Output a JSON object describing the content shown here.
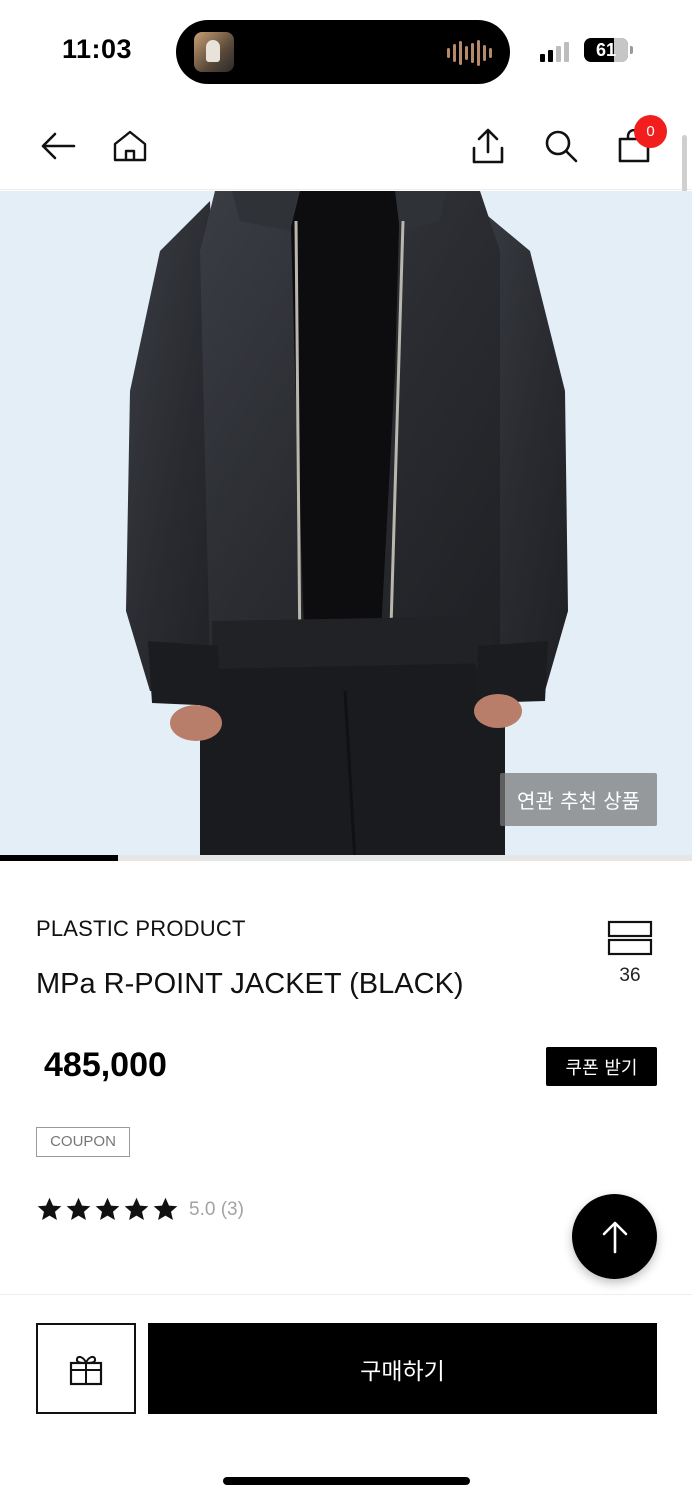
{
  "status_bar": {
    "time": "11:03",
    "battery": "61",
    "icons": [
      "now-playing-thumbnail",
      "audio-waveform-icon",
      "cellular-signal-icon",
      "battery-icon"
    ]
  },
  "nav": {
    "icons": [
      "back-arrow-icon",
      "home-icon",
      "share-icon",
      "search-icon",
      "shopping-bag-icon"
    ],
    "cart_count": "0"
  },
  "hero": {
    "related_label": "연관 추천 상품",
    "progress": 0.17
  },
  "product": {
    "brand": "PLASTIC PRODUCT",
    "name": "MPa R-POINT JACKET (BLACK)",
    "like_count": "36",
    "price": "485,000",
    "coupon_button": "쿠폰 받기",
    "coupon_tag": "COUPON",
    "rating_text": "5.0 (3)",
    "stars": 5
  },
  "actions": {
    "buy_label": "구매하기",
    "icons": [
      "gift-icon",
      "arrow-up-icon"
    ]
  },
  "colors": {
    "accent": "#000000",
    "badge": "#f21d1d",
    "hero_bg": "#e3eef7"
  }
}
